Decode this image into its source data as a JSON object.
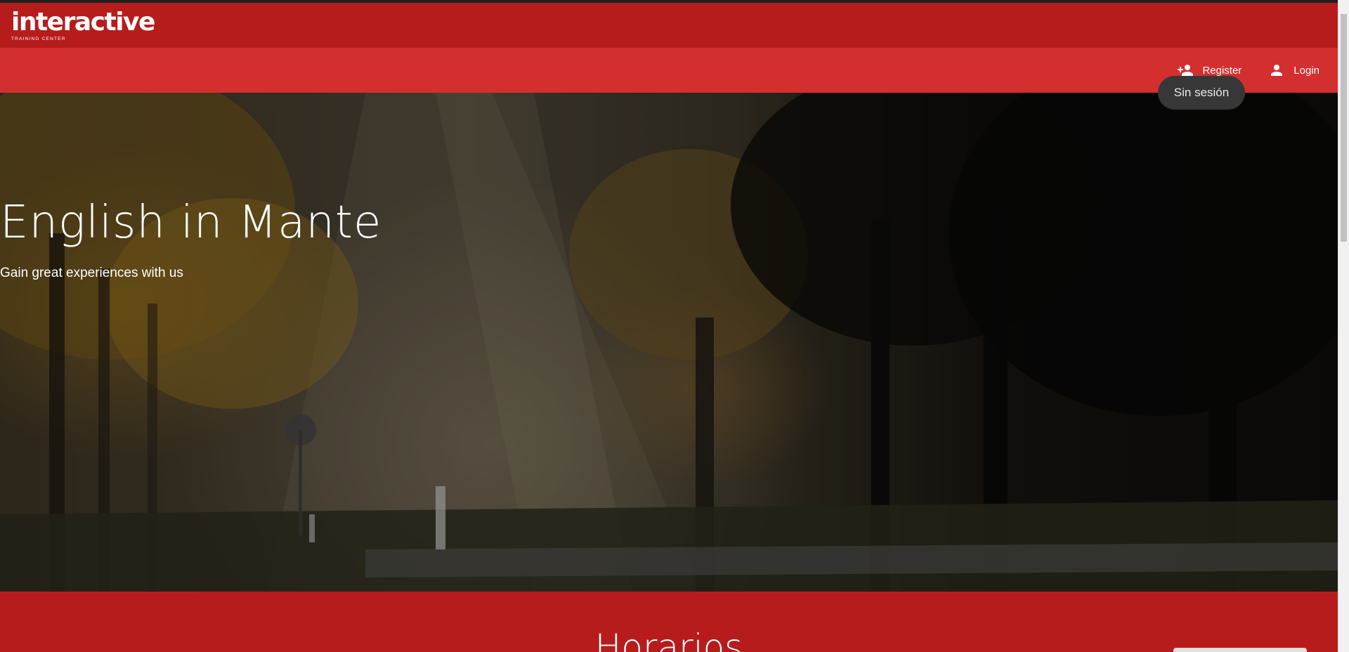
{
  "header": {
    "logo": {
      "word": "interactive",
      "subtitle": "TRAINING CENTER"
    }
  },
  "nav": {
    "register_label": "Register",
    "register_icon": "person-add-icon",
    "login_label": "Login",
    "login_icon": "person-icon"
  },
  "tooltip": {
    "text": "Sin sesión"
  },
  "hero": {
    "title": "English in Mante",
    "subtitle": "Gain great experiences with us"
  },
  "section": {
    "title": "Horarios"
  },
  "colors": {
    "header_dark": "#b71c1c",
    "header_light": "#d32f2f",
    "tooltip_bg": "#373737"
  }
}
